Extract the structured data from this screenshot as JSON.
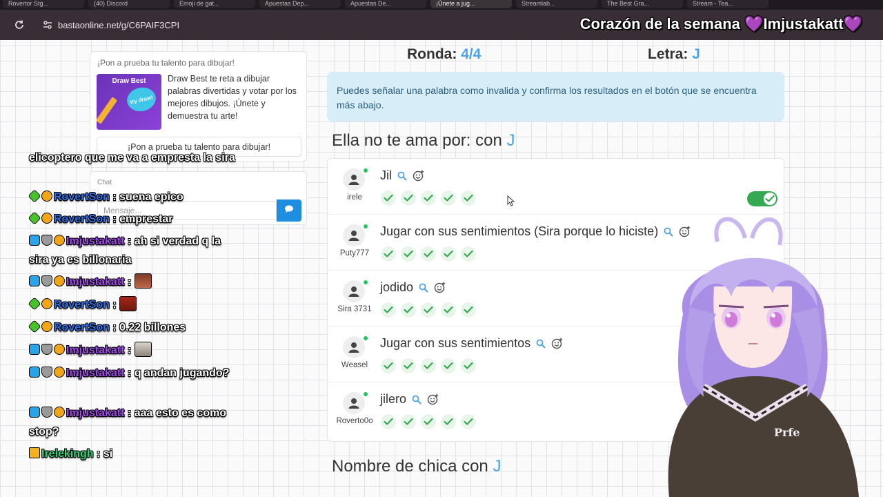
{
  "browser": {
    "tabs": [
      "Rovertor Stg...",
      "(40) Discord",
      "Emoji de gat...",
      "Apuestas Dep...",
      "Apuestas De...",
      "¡Únete a jug...",
      "Streamlab...",
      "The Best Gra...",
      "Stream - Tea..."
    ],
    "active_tab_index": 5,
    "url": "bastaonline.net/g/C6PAIF3CPI"
  },
  "overlay": {
    "title": "Corazón de la semana",
    "heart": "💜",
    "user": "Imjustakatt",
    "heart_end": "💜"
  },
  "ad": {
    "heading": "¡Pon a prueba tu talento para dibujar!",
    "image_title": "Draw Best",
    "image_bubble": "try draw!",
    "text": "Draw Best te reta a dibujar palabras divertidas y votar por los mejores dibujos. ¡Únete y demuestra tu arte!",
    "button_label": "¡Pon a prueba tu talento para dibujar!"
  },
  "site_chat": {
    "label": "Chat",
    "placeholder": "Mensaje...",
    "send_icon": "chat-bubble-icon"
  },
  "stream_chat": [
    {
      "text": "elicoptero que me va a empresta la sira"
    },
    {
      "badges": [
        "green",
        "gold"
      ],
      "user": "RovertSon",
      "user_class": "u-rovert",
      "text": ": suena epico"
    },
    {
      "badges": [
        "green",
        "gold"
      ],
      "user": "RovertSon",
      "user_class": "u-rovert",
      "text": ": emprestar"
    },
    {
      "badges": [
        "blue",
        "silver",
        "gold"
      ],
      "user": "Imjustakatt",
      "user_class": "u-imjusta",
      "text": ": ah si verdad q la sira ya es billonaria"
    },
    {
      "badges": [
        "blue",
        "silver",
        "gold"
      ],
      "user": "Imjustakatt",
      "user_class": "u-imjusta",
      "text": ":",
      "emote": "e1"
    },
    {
      "badges": [
        "green",
        "gold"
      ],
      "user": "RovertSon",
      "user_class": "u-rovert",
      "text": ":",
      "emote": "e2"
    },
    {
      "badges": [
        "green",
        "gold"
      ],
      "user": "RovertSon",
      "user_class": "u-rovert",
      "text": ": 0.22 billones"
    },
    {
      "badges": [
        "blue",
        "silver",
        "gold"
      ],
      "user": "Imjustakatt",
      "user_class": "u-imjusta",
      "text": ":",
      "emote": "e3"
    },
    {
      "badges": [
        "blue",
        "silver",
        "gold"
      ],
      "user": "Imjustakatt",
      "user_class": "u-imjusta",
      "text": ": q andan jugando?"
    },
    {
      "badges": [
        "blue",
        "silver",
        "gold"
      ],
      "user": "Imjustakatt",
      "user_class": "u-imjusta",
      "text": ": aaa esto es como stop?"
    },
    {
      "badges": [
        "crown"
      ],
      "user": "Irelekingh",
      "user_class": "u-irele",
      "text": ": si"
    }
  ],
  "game": {
    "round_label": "Ronda:",
    "round_value": "4/4",
    "letter_label": "Letra:",
    "letter_value": "J",
    "info": "Puedes señalar una palabra como invalida y confirma los resultados en el botón que se encuentra más abajo.",
    "categories": [
      {
        "title": "Ella no te ama por: con",
        "letter": "J",
        "answers": [
          {
            "word": "Jil",
            "player": "irele",
            "votes": 5,
            "has_toggle": true,
            "toggle_on": true
          },
          {
            "word": "Jugar con sus sentimientos (Sira porque lo hiciste)",
            "player": "Puty777",
            "votes": 5
          },
          {
            "word": "jodido",
            "player": "Sira 3731",
            "votes": 5
          },
          {
            "word": "Jugar con sus sentimientos",
            "player": "Weasel",
            "votes": 5
          },
          {
            "word": "jilero",
            "player": "Roverto0o",
            "votes": 5
          }
        ]
      },
      {
        "title": "Nombre de chica con",
        "letter": "J"
      }
    ]
  },
  "colors": {
    "accent": "#4ba3e6",
    "info_bg": "#d7eef9",
    "toggle_on": "#34a853",
    "check": "#34a853"
  }
}
